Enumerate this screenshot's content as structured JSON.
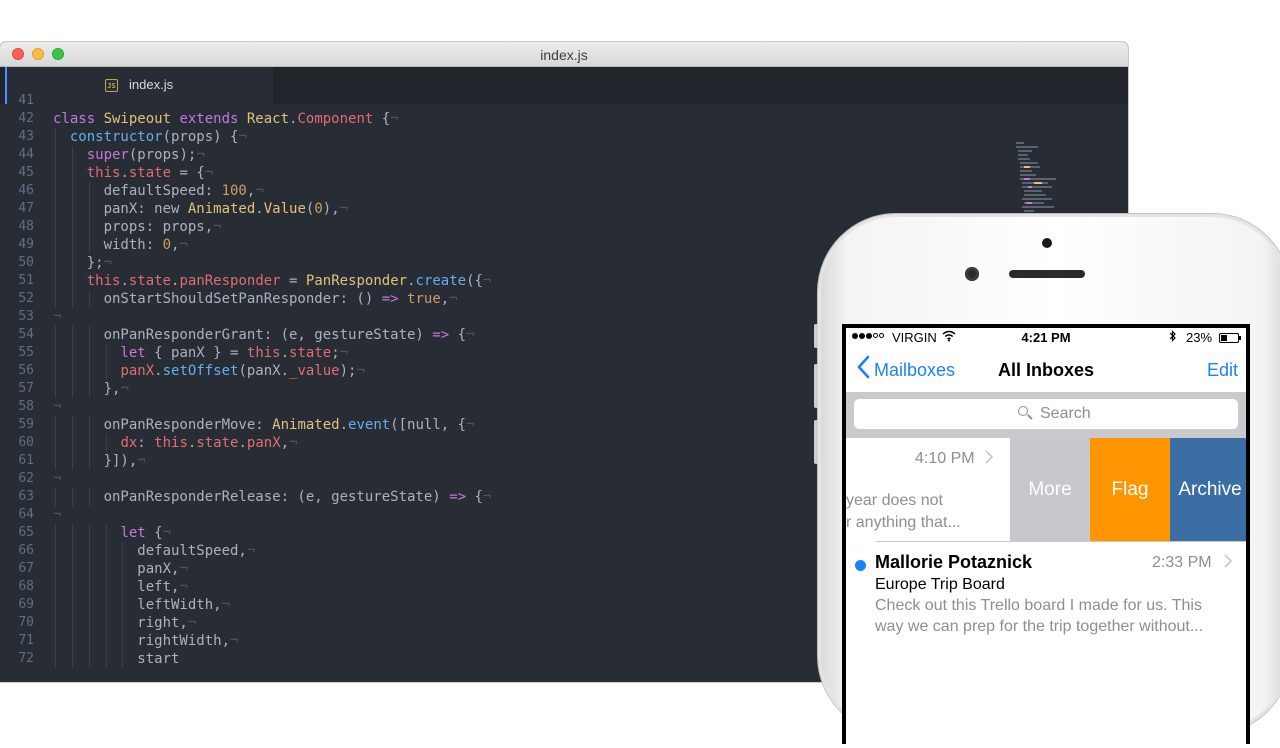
{
  "window": {
    "title": "index.js"
  },
  "tabs": [
    {
      "label": "index.js",
      "icon": "js-file-icon"
    }
  ],
  "editor": {
    "lines": [
      {
        "n": "41",
        "segs": []
      },
      {
        "n": "42",
        "segs": [
          {
            "t": "kw",
            "v": "class "
          },
          {
            "t": "ty",
            "v": "Swipeout "
          },
          {
            "t": "kw",
            "v": "extends "
          },
          {
            "t": "ty",
            "v": "React"
          },
          {
            "t": "pl",
            "v": "."
          },
          {
            "t": "prop",
            "v": "Component"
          },
          {
            "t": "pl",
            "v": " {"
          },
          {
            "t": "inv",
            "v": "¬"
          }
        ]
      },
      {
        "n": "43",
        "segs": [
          {
            "t": "pl",
            "v": "  "
          },
          {
            "t": "fn",
            "v": "constructor"
          },
          {
            "t": "pl",
            "v": "(props) {"
          },
          {
            "t": "inv",
            "v": "¬"
          }
        ]
      },
      {
        "n": "44",
        "segs": [
          {
            "t": "pl",
            "v": "    "
          },
          {
            "t": "kw",
            "v": "super"
          },
          {
            "t": "pl",
            "v": "(props);"
          },
          {
            "t": "inv",
            "v": "¬"
          }
        ]
      },
      {
        "n": "45",
        "segs": [
          {
            "t": "pl",
            "v": "    "
          },
          {
            "t": "prop",
            "v": "this"
          },
          {
            "t": "pl",
            "v": "."
          },
          {
            "t": "prop",
            "v": "state"
          },
          {
            "t": "pl",
            "v": " = {"
          },
          {
            "t": "inv",
            "v": "¬"
          }
        ]
      },
      {
        "n": "46",
        "segs": [
          {
            "t": "pl",
            "v": "      defaultSpeed: "
          },
          {
            "t": "num",
            "v": "100"
          },
          {
            "t": "pl",
            "v": ","
          },
          {
            "t": "inv",
            "v": "¬"
          }
        ]
      },
      {
        "n": "47",
        "segs": [
          {
            "t": "pl",
            "v": "      panX: new "
          },
          {
            "t": "ty",
            "v": "Animated"
          },
          {
            "t": "pl",
            "v": "."
          },
          {
            "t": "ty",
            "v": "Value"
          },
          {
            "t": "pl",
            "v": "("
          },
          {
            "t": "num",
            "v": "0"
          },
          {
            "t": "pl",
            "v": "),"
          },
          {
            "t": "inv",
            "v": "¬"
          }
        ]
      },
      {
        "n": "48",
        "segs": [
          {
            "t": "pl",
            "v": "      props: props,"
          },
          {
            "t": "inv",
            "v": "¬"
          }
        ]
      },
      {
        "n": "49",
        "segs": [
          {
            "t": "pl",
            "v": "      width: "
          },
          {
            "t": "num",
            "v": "0"
          },
          {
            "t": "pl",
            "v": ","
          },
          {
            "t": "inv",
            "v": "¬"
          }
        ]
      },
      {
        "n": "50",
        "segs": [
          {
            "t": "pl",
            "v": "    };"
          },
          {
            "t": "inv",
            "v": "¬"
          }
        ]
      },
      {
        "n": "51",
        "segs": [
          {
            "t": "pl",
            "v": "    "
          },
          {
            "t": "prop",
            "v": "this"
          },
          {
            "t": "pl",
            "v": "."
          },
          {
            "t": "prop",
            "v": "state"
          },
          {
            "t": "pl",
            "v": "."
          },
          {
            "t": "prop",
            "v": "panResponder"
          },
          {
            "t": "pl",
            "v": " = "
          },
          {
            "t": "ty",
            "v": "PanResponder"
          },
          {
            "t": "pl",
            "v": "."
          },
          {
            "t": "fn",
            "v": "create"
          },
          {
            "t": "pl",
            "v": "({"
          },
          {
            "t": "inv",
            "v": "¬"
          }
        ]
      },
      {
        "n": "52",
        "segs": [
          {
            "t": "pl",
            "v": "      onStartShouldSetPanResponder: () "
          },
          {
            "t": "op",
            "v": "=>"
          },
          {
            "t": "pl",
            "v": " "
          },
          {
            "t": "num",
            "v": "true"
          },
          {
            "t": "pl",
            "v": ","
          },
          {
            "t": "inv",
            "v": "¬"
          }
        ]
      },
      {
        "n": "53",
        "segs": [
          {
            "t": "inv",
            "v": "¬"
          }
        ]
      },
      {
        "n": "54",
        "segs": [
          {
            "t": "pl",
            "v": "      onPanResponderGrant: (e, gestureState) "
          },
          {
            "t": "op",
            "v": "=>"
          },
          {
            "t": "pl",
            "v": " {"
          },
          {
            "t": "inv",
            "v": "¬"
          }
        ]
      },
      {
        "n": "55",
        "segs": [
          {
            "t": "pl",
            "v": "        "
          },
          {
            "t": "kw",
            "v": "let"
          },
          {
            "t": "pl",
            "v": " { panX } = "
          },
          {
            "t": "prop",
            "v": "this"
          },
          {
            "t": "pl",
            "v": "."
          },
          {
            "t": "prop",
            "v": "state"
          },
          {
            "t": "pl",
            "v": ";"
          },
          {
            "t": "inv",
            "v": "¬"
          }
        ]
      },
      {
        "n": "56",
        "segs": [
          {
            "t": "pl",
            "v": "        "
          },
          {
            "t": "prop",
            "v": "panX"
          },
          {
            "t": "pl",
            "v": "."
          },
          {
            "t": "fn",
            "v": "setOffset"
          },
          {
            "t": "pl",
            "v": "(panX."
          },
          {
            "t": "prop",
            "v": "_value"
          },
          {
            "t": "pl",
            "v": ");"
          },
          {
            "t": "inv",
            "v": "¬"
          }
        ]
      },
      {
        "n": "57",
        "segs": [
          {
            "t": "pl",
            "v": "      },"
          },
          {
            "t": "inv",
            "v": "¬"
          }
        ]
      },
      {
        "n": "58",
        "segs": [
          {
            "t": "inv",
            "v": "¬"
          }
        ]
      },
      {
        "n": "59",
        "segs": [
          {
            "t": "pl",
            "v": "      onPanResponderMove: "
          },
          {
            "t": "ty",
            "v": "Animated"
          },
          {
            "t": "pl",
            "v": "."
          },
          {
            "t": "fn",
            "v": "event"
          },
          {
            "t": "pl",
            "v": "([null, {"
          },
          {
            "t": "inv",
            "v": "¬"
          }
        ]
      },
      {
        "n": "60",
        "segs": [
          {
            "t": "pl",
            "v": "        "
          },
          {
            "t": "prop",
            "v": "dx"
          },
          {
            "t": "pl",
            "v": ": "
          },
          {
            "t": "prop",
            "v": "this"
          },
          {
            "t": "pl",
            "v": "."
          },
          {
            "t": "prop",
            "v": "state"
          },
          {
            "t": "pl",
            "v": "."
          },
          {
            "t": "prop",
            "v": "panX"
          },
          {
            "t": "pl",
            "v": ","
          },
          {
            "t": "inv",
            "v": "¬"
          }
        ]
      },
      {
        "n": "61",
        "segs": [
          {
            "t": "pl",
            "v": "      }]),"
          },
          {
            "t": "inv",
            "v": "¬"
          }
        ]
      },
      {
        "n": "62",
        "segs": [
          {
            "t": "inv",
            "v": "¬"
          }
        ]
      },
      {
        "n": "63",
        "segs": [
          {
            "t": "pl",
            "v": "      onPanResponderRelease: (e, gestureState) "
          },
          {
            "t": "op",
            "v": "=>"
          },
          {
            "t": "pl",
            "v": " {"
          },
          {
            "t": "inv",
            "v": "¬"
          }
        ]
      },
      {
        "n": "64",
        "segs": [
          {
            "t": "inv",
            "v": "¬"
          }
        ]
      },
      {
        "n": "65",
        "segs": [
          {
            "t": "pl",
            "v": "        "
          },
          {
            "t": "kw",
            "v": "let"
          },
          {
            "t": "pl",
            "v": " {"
          },
          {
            "t": "inv",
            "v": "¬"
          }
        ]
      },
      {
        "n": "66",
        "segs": [
          {
            "t": "pl",
            "v": "          defaultSpeed,"
          },
          {
            "t": "inv",
            "v": "¬"
          }
        ]
      },
      {
        "n": "67",
        "segs": [
          {
            "t": "pl",
            "v": "          panX,"
          },
          {
            "t": "inv",
            "v": "¬"
          }
        ]
      },
      {
        "n": "68",
        "segs": [
          {
            "t": "pl",
            "v": "          left,"
          },
          {
            "t": "inv",
            "v": "¬"
          }
        ]
      },
      {
        "n": "69",
        "segs": [
          {
            "t": "pl",
            "v": "          leftWidth,"
          },
          {
            "t": "inv",
            "v": "¬"
          }
        ]
      },
      {
        "n": "70",
        "segs": [
          {
            "t": "pl",
            "v": "          right,"
          },
          {
            "t": "inv",
            "v": "¬"
          }
        ]
      },
      {
        "n": "71",
        "segs": [
          {
            "t": "pl",
            "v": "          rightWidth,"
          },
          {
            "t": "inv",
            "v": "¬"
          }
        ]
      },
      {
        "n": "72",
        "segs": [
          {
            "t": "pl",
            "v": "          start"
          }
        ]
      }
    ]
  },
  "phone": {
    "status": {
      "carrier": "VIRGIN",
      "time": "4:21 PM",
      "battery": "23%",
      "battery_level": 0.23
    },
    "nav": {
      "back": "Mailboxes",
      "title": "All Inboxes",
      "edit": "Edit"
    },
    "search": {
      "placeholder": "Search"
    },
    "row1": {
      "time": "4:10 PM",
      "line1": "year does not",
      "line2": "r anything that...",
      "actions": [
        "More",
        "Flag",
        "Archive"
      ]
    },
    "row2": {
      "sender": "Mallorie Potaznick",
      "time": "2:33 PM",
      "subject": "Europe Trip Board",
      "preview1": "Check out this Trello board I made for us. This",
      "preview2": "way we can prep for the trip together without..."
    }
  },
  "colors": {
    "editor_bg": "#282c34",
    "ios_blue": "#1a82fb",
    "flag_orange": "#ff9500",
    "archive_blue": "#3a6ea5",
    "more_gray": "#c7c7cc"
  }
}
